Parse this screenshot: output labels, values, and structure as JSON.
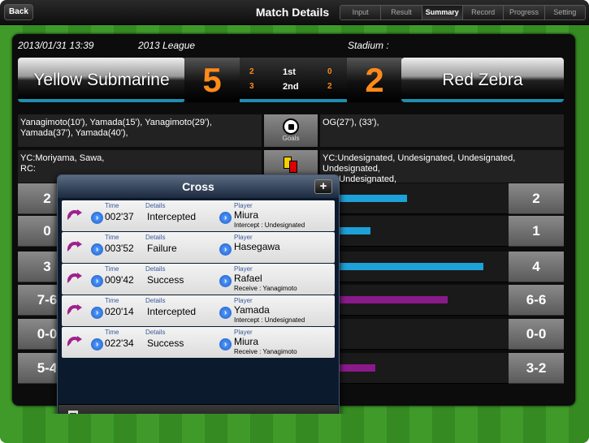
{
  "nav": {
    "back": "Back",
    "title": "Match Details",
    "tabs": [
      "Input",
      "Result",
      "Summary",
      "Record",
      "Progress",
      "Setting"
    ],
    "active_tab": "Summary"
  },
  "match": {
    "datetime": "2013/01/31 13:39",
    "league": "2013 League",
    "stadium": "Stadium :",
    "home": "Yellow Submarine",
    "away": "Red Zebra",
    "home_score": "5",
    "away_score": "2",
    "halves": [
      {
        "home": "2",
        "label": "1st",
        "away": "0"
      },
      {
        "home": "3",
        "label": "2nd",
        "away": "2"
      }
    ]
  },
  "goals": {
    "home": "Yanagimoto(10'), Yamada(15'), Yanagimoto(29'), Yamada(37'), Yamada(40'),",
    "label": "Goals",
    "away": "OG(27'), (33'),"
  },
  "cards": {
    "home_yc": "YC:Moriyama, Sawa,",
    "home_rc": "RC:",
    "away_yc": "YC:Undesignated, Undesignated, Undesignated, Undesignated,",
    "away_rc": "OG:Undesignated,"
  },
  "stats": [
    {
      "left": "2",
      "right": "2",
      "bar_color": "#1ea0d8",
      "bar_fraction": 0.16
    },
    {
      "left": "0",
      "right": "1",
      "bar_color": "#1ea0d8",
      "bar_fraction": 0.08
    },
    {
      "left": "3",
      "right": "4",
      "bar_color": "#1ea0d8",
      "bar_fraction": 0.33
    },
    {
      "left": "7-6",
      "right": "6-6",
      "bar_color": "#8a1a8a",
      "bar_fraction": 0.25
    },
    {
      "left": "0-0",
      "right": "0-0",
      "bar_color": "#1ea0d8",
      "bar_fraction": 0
    },
    {
      "left": "5-4",
      "right": "3-2",
      "bar_color": "#8a1a8a",
      "bar_fraction": 0.09
    }
  ],
  "popover": {
    "title": "Cross",
    "plus": "+",
    "col_time": "Time",
    "col_details": "Details",
    "col_player": "Player",
    "events": [
      {
        "time": "002'37",
        "details": "Intercepted",
        "player": "Miura",
        "sub": "Intercept : Undesignated"
      },
      {
        "time": "003'52",
        "details": "Failure",
        "player": "Hasegawa",
        "sub": ""
      },
      {
        "time": "009'42",
        "details": "Success",
        "player": "Rafael",
        "sub": "Receive : Yanagimoto"
      },
      {
        "time": "020'14",
        "details": "Intercepted",
        "player": "Yamada",
        "sub": "Intercept : Undesignated"
      },
      {
        "time": "022'34",
        "details": "Success",
        "player": "Miura",
        "sub": "Receive : Yanagimoto"
      }
    ]
  },
  "colors": {
    "accent": "#1ea0d8",
    "score": "#ff8a1a",
    "cross": "#a0208a"
  }
}
